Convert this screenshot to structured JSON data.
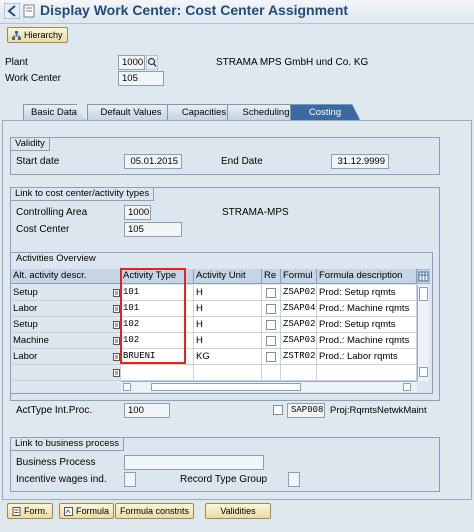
{
  "title": "Display Work Center: Cost Center Assignment",
  "toolbar": {
    "hierarchy": "Hierarchy"
  },
  "header": {
    "plant_label": "Plant",
    "plant_value": "1000",
    "plant_name": "STRAMA MPS GmbH und Co. KG",
    "workcenter_label": "Work Center",
    "workcenter_value": "105"
  },
  "tabs": [
    {
      "label": "Basic Data"
    },
    {
      "label": "Default Values"
    },
    {
      "label": "Capacities"
    },
    {
      "label": "Scheduling"
    },
    {
      "label": "Costing",
      "active": true
    }
  ],
  "validity": {
    "title": "Validity",
    "start_label": "Start date",
    "start_value": "05.01.2015",
    "end_label": "End Date",
    "end_value": "31.12.9999"
  },
  "link_cc": {
    "title": "Link to cost center/activity types",
    "controlling_area_label": "Controlling Area",
    "controlling_area_value": "1000",
    "controlling_area_name": "STRAMA-MPS",
    "cost_center_label": "Cost Center",
    "cost_center_value": "105"
  },
  "activities": {
    "title": "Activities Overview",
    "headers": [
      "Alt. activity descr.",
      "Activity Type",
      "Activity Unit",
      "Re",
      "Formul",
      "Formula description"
    ],
    "rows": [
      {
        "descr": "Setup",
        "type": "101",
        "unit": "H",
        "formula": "ZSAP02",
        "formula_desc": "Prod: Setup rqmts"
      },
      {
        "descr": "Labor",
        "type": "101",
        "unit": "H",
        "formula": "ZSAP04",
        "formula_desc": "Prod.: Machine rqmts"
      },
      {
        "descr": "Setup",
        "type": "102",
        "unit": "H",
        "formula": "ZSAP02",
        "formula_desc": "Prod: Setup rqmts"
      },
      {
        "descr": "Machine",
        "type": "102",
        "unit": "H",
        "formula": "ZSAP03",
        "formula_desc": "Prod.: Machine rqmts"
      },
      {
        "descr": "Labor",
        "type": "BRUENI",
        "unit": "KG",
        "formula": "ZSTR02",
        "formula_desc": "Prod.: Labor rqmts"
      },
      {
        "descr": "",
        "type": "",
        "unit": "",
        "formula": "",
        "formula_desc": ""
      }
    ]
  },
  "acttype": {
    "label": "ActType Int.Proc.",
    "value": "100",
    "formula": "SAP008",
    "formula_desc": "Proj:RqmtsNetwkMaint"
  },
  "link_bp": {
    "title": "Link to business process",
    "bp_label": "Business Process",
    "incentive_label": "Incentive wages ind.",
    "record_type_label": "Record Type Group"
  },
  "bottom_buttons": {
    "form": "Form.",
    "formula": "Formula",
    "constnts": "Formula constnts",
    "validities": "Validities"
  },
  "colors": {
    "title": "#1f4c7d",
    "active_tab": "#3a6aa2",
    "highlight": "#e8231b"
  }
}
